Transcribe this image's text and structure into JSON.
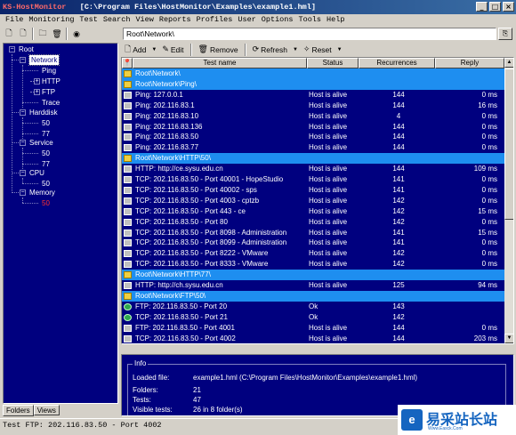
{
  "window": {
    "app_name": "KS-HostMonitor",
    "title_path": "[C:\\Program Files\\HostMonitor\\Examples\\example1.hml]",
    "controls": [
      "_",
      "□",
      "×"
    ]
  },
  "menu": [
    "File",
    "Monitoring",
    "Test",
    "Search",
    "View",
    "Reports",
    "Profiles",
    "User",
    "Options",
    "Tools",
    "Help"
  ],
  "folder_path": "Root\\Network\\",
  "actions": {
    "add": "Add",
    "edit": "Edit",
    "remove": "Remove",
    "refresh": "Refresh",
    "reset": "Reset"
  },
  "tree": {
    "root": "Root",
    "network": "Network",
    "ping": "Ping",
    "http": "HTTP",
    "ftp": "FTP",
    "trace": "Trace",
    "harddisk": "Harddisk",
    "hd50": "50",
    "hd77": "77",
    "service": "Service",
    "sv50": "50",
    "sv77": "77",
    "cpu": "CPU",
    "cpu50": "50",
    "memory": "Memory",
    "mem50": "50"
  },
  "left_tabs": [
    "Folders",
    "Views"
  ],
  "columns": [
    "Test name",
    "Status",
    "Recurrences",
    "Reply"
  ],
  "rows": [
    {
      "type": "folder",
      "name": "Root\\Network\\",
      "status": "",
      "rec": "",
      "reply": ""
    },
    {
      "type": "folder",
      "name": "Root\\Network\\Ping\\",
      "status": "",
      "rec": "",
      "reply": ""
    },
    {
      "type": "test",
      "name": "Ping: 127.0.0.1",
      "status": "Host is alive",
      "rec": "144",
      "reply": "0 ms"
    },
    {
      "type": "test",
      "name": "Ping: 202.116.83.1",
      "status": "Host is alive",
      "rec": "144",
      "reply": "16 ms"
    },
    {
      "type": "test",
      "name": "Ping: 202.116.83.10",
      "status": "Host is alive",
      "rec": "4",
      "reply": "0 ms"
    },
    {
      "type": "test",
      "name": "Ping: 202.116.83.136",
      "status": "Host is alive",
      "rec": "144",
      "reply": "0 ms"
    },
    {
      "type": "test",
      "name": "Ping: 202.116.83.50",
      "status": "Host is alive",
      "rec": "144",
      "reply": "0 ms"
    },
    {
      "type": "test",
      "name": "Ping: 202.116.83.77",
      "status": "Host is alive",
      "rec": "144",
      "reply": "0 ms"
    },
    {
      "type": "folder",
      "name": "Root\\Network\\HTTP\\50\\",
      "status": "",
      "rec": "",
      "reply": ""
    },
    {
      "type": "test",
      "name": "HTTP: http://ce.sysu.edu.cn",
      "status": "Host is alive",
      "rec": "144",
      "reply": "109 ms"
    },
    {
      "type": "test",
      "name": "TCP: 202.116.83.50 - Port 40001 - HopeStudio",
      "status": "Host is alive",
      "rec": "141",
      "reply": "0 ms"
    },
    {
      "type": "test",
      "name": "TCP: 202.116.83.50 - Port 40002 - sps",
      "status": "Host is alive",
      "rec": "141",
      "reply": "0 ms"
    },
    {
      "type": "test",
      "name": "TCP: 202.116.83.50 - Port 4003 - cptzb",
      "status": "Host is alive",
      "rec": "142",
      "reply": "0 ms"
    },
    {
      "type": "test",
      "name": "TCP: 202.116.83.50 - Port 443 - ce",
      "status": "Host is alive",
      "rec": "142",
      "reply": "15 ms"
    },
    {
      "type": "test",
      "name": "TCP: 202.116.83.50 - Port 80",
      "status": "Host is alive",
      "rec": "142",
      "reply": "0 ms"
    },
    {
      "type": "test",
      "name": "TCP: 202.116.83.50 - Port 8098 - Administration",
      "status": "Host is alive",
      "rec": "141",
      "reply": "15 ms"
    },
    {
      "type": "test",
      "name": "TCP: 202.116.83.50 - Port 8099 - Administration",
      "status": "Host is alive",
      "rec": "141",
      "reply": "0 ms"
    },
    {
      "type": "test",
      "name": "TCP: 202.116.83.50 - Port 8222 - VMware",
      "status": "Host is alive",
      "rec": "142",
      "reply": "0 ms"
    },
    {
      "type": "test",
      "name": "TCP: 202.116.83.50 - Port 8333 - VMware",
      "status": "Host is alive",
      "rec": "142",
      "reply": "0 ms"
    },
    {
      "type": "folder",
      "name": "Root\\Network\\HTTP\\77\\",
      "status": "",
      "rec": "",
      "reply": ""
    },
    {
      "type": "test",
      "name": "HTTP: http://ch.sysu.edu.cn",
      "status": "Host is alive",
      "rec": "125",
      "reply": "94 ms"
    },
    {
      "type": "folder",
      "name": "Root\\Network\\FTP\\50\\",
      "status": "",
      "rec": "",
      "reply": ""
    },
    {
      "type": "ok",
      "name": "FTP: 202.116.83.50 - Port 20",
      "status": "Ok",
      "rec": "143",
      "reply": ""
    },
    {
      "type": "ok",
      "name": "TCP: 202.116.83.50 - Port 21",
      "status": "Ok",
      "rec": "142",
      "reply": ""
    },
    {
      "type": "test",
      "name": "FTP: 202.116.83.50 - Port 4001",
      "status": "Host is alive",
      "rec": "144",
      "reply": "0 ms"
    },
    {
      "type": "test",
      "name": "TCP: 202.116.83.50 - Port 4002",
      "status": "Host is alive",
      "rec": "144",
      "reply": "203 ms"
    }
  ],
  "info": {
    "title": "Info",
    "loaded_label": "Loaded file:",
    "loaded_value": "example1.hml  (C:\\Program Files\\HostMonitor\\Examples\\example1.hml)",
    "folders_label": "Folders:",
    "folders_value": "21",
    "tests_label": "Tests:",
    "tests_value": "47",
    "visible_label": "Visible tests:",
    "visible_value": "26 in 8 folder(s)"
  },
  "statusbar": "Test FTP: 202.116.83.50 - Port 4002",
  "watermark": {
    "logo": "e",
    "text": "易采站长站",
    "sub": "Www.Easck.Com"
  },
  "colors": {
    "panel_bg": "#00007f",
    "folder_row": "#1e8ef0",
    "window_gray": "#d4d0c8",
    "alert_text": "#ff3030"
  }
}
